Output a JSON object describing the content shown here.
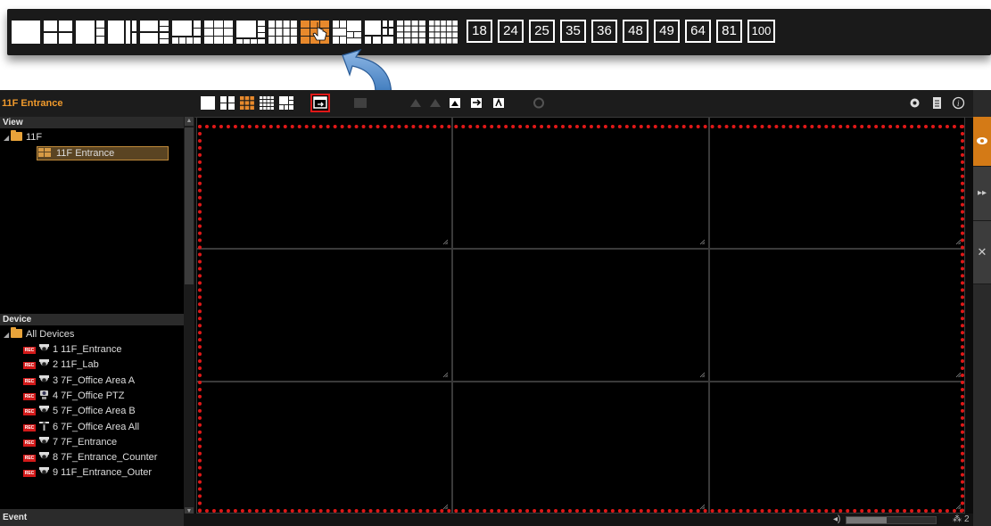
{
  "layout_bar": {
    "items": [
      {
        "name": "layout-1x1-icon",
        "grid": "1"
      },
      {
        "name": "layout-2x2-icon",
        "grid": "4"
      },
      {
        "name": "layout-1plus3-icon",
        "grid": "1p3"
      },
      {
        "name": "layout-1plus5-icon",
        "grid": "1p5"
      },
      {
        "name": "layout-1plus7-icon",
        "grid": "1p7"
      },
      {
        "name": "layout-1plus9-icon",
        "grid": "1p9"
      },
      {
        "name": "layout-3x3-icon",
        "grid": "9"
      },
      {
        "name": "layout-1plus12-icon",
        "grid": "1p12"
      },
      {
        "name": "layout-4x3-icon",
        "grid": "12"
      },
      {
        "name": "layout-3x3-selected-icon",
        "grid": "9s"
      },
      {
        "name": "layout-2plus8-icon",
        "grid": "2p8"
      },
      {
        "name": "layout-1plus16-icon",
        "grid": "1p16"
      },
      {
        "name": "layout-4x4-icon",
        "grid": "16"
      },
      {
        "name": "layout-5x4-icon",
        "grid": "20"
      }
    ],
    "numbers": [
      "18",
      "24",
      "25",
      "35",
      "36",
      "48",
      "49",
      "64",
      "81",
      "100"
    ],
    "selected_color": "#e8892c"
  },
  "app": {
    "title": "11F Entrance",
    "accent_color": "#f09a2c",
    "toolbar_right": [
      "gear-icon",
      "document-icon",
      "info-icon"
    ]
  },
  "view_panel": {
    "header": "View",
    "tree": [
      {
        "label": "11F",
        "type": "folder"
      },
      {
        "label": "11F Entrance",
        "type": "view",
        "selected": true
      }
    ]
  },
  "device_panel": {
    "header": "Device",
    "root": "All Devices",
    "devices": [
      {
        "label": "1 11F_Entrance",
        "icon": "dome-camera-icon"
      },
      {
        "label": "2 11F_Lab",
        "icon": "dome-camera-icon"
      },
      {
        "label": "3 7F_Office Area A",
        "icon": "dome-camera-icon"
      },
      {
        "label": "4 7F_Office PTZ",
        "icon": "ptz-camera-icon"
      },
      {
        "label": "5 7F_Office Area B",
        "icon": "dome-camera-icon"
      },
      {
        "label": "6 7F_Office Area All",
        "icon": "fisheye-camera-icon"
      },
      {
        "label": "7 7F_Entrance",
        "icon": "dome-camera-icon"
      },
      {
        "label": "8 7F_Entrance_Counter",
        "icon": "dome-camera-icon"
      },
      {
        "label": "9 11F_Entrance_Outer",
        "icon": "dome-camera-icon"
      }
    ],
    "rec_label": "REC"
  },
  "event_panel": {
    "header": "Event"
  },
  "video_grid": {
    "rows": 3,
    "cols": 3
  },
  "status": {
    "count": "2"
  }
}
